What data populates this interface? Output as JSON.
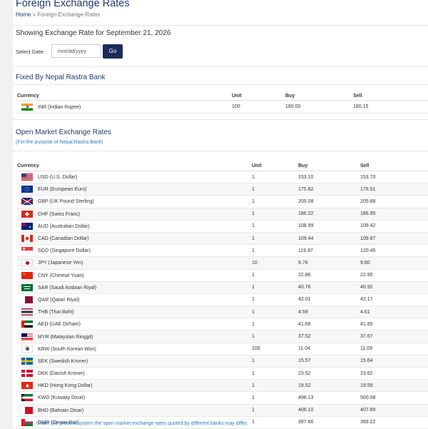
{
  "page": {
    "title": "Foreign Exchange Rates",
    "breadcrumb": {
      "home": "Home",
      "separator": "»",
      "current": "Foreign Exchange Rates"
    }
  },
  "date_form": {
    "heading": "Showing Exchange Rate for September 21, 2026",
    "label": "Select Date:",
    "placeholder": "mm/dd/yyyy",
    "button": "Go"
  },
  "fixed": {
    "heading": "Fixed By Nepal Rastra Bank",
    "columns": [
      "Currency",
      "Unit",
      "Buy",
      "Sell"
    ],
    "rows": [
      {
        "flag": "IN",
        "currency": "INR (Indian Rupee)",
        "unit": "100",
        "buy": "160.00",
        "sell": "160.15"
      }
    ]
  },
  "open_market": {
    "heading": "Open Market Exchange Rates",
    "subheading": "(For the purpose of Nepal Rastra Bank)",
    "columns": [
      "Currency",
      "Unit",
      "Buy",
      "Sell"
    ],
    "rows": [
      {
        "flag": "US",
        "currency": "USD (U.S. Dollar)",
        "unit": "1",
        "buy": "153.10",
        "sell": "153.70"
      },
      {
        "flag": "EU",
        "currency": "EUR (European Euro)",
        "unit": "1",
        "buy": "175.82",
        "sell": "176.51"
      },
      {
        "flag": "GB",
        "currency": "GBP (UK Pound Sterling)",
        "unit": "1",
        "buy": "205.08",
        "sell": "205.88"
      },
      {
        "flag": "CH",
        "currency": "CHF (Swiss Franc)",
        "unit": "1",
        "buy": "186.22",
        "sell": "186.95"
      },
      {
        "flag": "AU",
        "currency": "AUD (Australian Dollar)",
        "unit": "1",
        "buy": "108.99",
        "sell": "109.42"
      },
      {
        "flag": "CA",
        "currency": "CAD (Canadian Dollar)",
        "unit": "1",
        "buy": "109.44",
        "sell": "109.87"
      },
      {
        "flag": "SG",
        "currency": "SGD (Singapore Dollar)",
        "unit": "1",
        "buy": "119.97",
        "sell": "120.45"
      },
      {
        "flag": "JP",
        "currency": "JPY (Japanese Yen)",
        "unit": "10",
        "buy": "9.76",
        "sell": "9.80"
      },
      {
        "flag": "CN",
        "currency": "CNY (Chinese Yuan)",
        "unit": "1",
        "buy": "22.86",
        "sell": "22.95"
      },
      {
        "flag": "SA",
        "currency": "SAR (Saudi Arabian Riyal)",
        "unit": "1",
        "buy": "40.76",
        "sell": "40.92"
      },
      {
        "flag": "QA",
        "currency": "QAR (Qatari Riyal)",
        "unit": "1",
        "buy": "42.01",
        "sell": "42.17"
      },
      {
        "flag": "TH",
        "currency": "THB (Thai Baht)",
        "unit": "1",
        "buy": "4.59",
        "sell": "4.61"
      },
      {
        "flag": "AE",
        "currency": "AED (UAE Dirham)",
        "unit": "1",
        "buy": "41.68",
        "sell": "41.85"
      },
      {
        "flag": "MY",
        "currency": "MYR (Malaysian Ringgit)",
        "unit": "1",
        "buy": "37.52",
        "sell": "37.67"
      },
      {
        "flag": "KR",
        "currency": "KRW (South Korean Won)",
        "unit": "100",
        "buy": "11.04",
        "sell": "11.09"
      },
      {
        "flag": "SE",
        "currency": "SEK (Swedish Kroner)",
        "unit": "1",
        "buy": "15.57",
        "sell": "15.64"
      },
      {
        "flag": "DK",
        "currency": "DKK (Danish Kroner)",
        "unit": "1",
        "buy": "23.52",
        "sell": "23.62"
      },
      {
        "flag": "HK",
        "currency": "HKD (Hong Kong Dollar)",
        "unit": "1",
        "buy": "19.52",
        "sell": "19.59"
      },
      {
        "flag": "KW",
        "currency": "KWD (Kuwaity Dinar)",
        "unit": "1",
        "buy": "498.13",
        "sell": "500.08"
      },
      {
        "flag": "BH",
        "currency": "BHD (Bahrain Dinar)",
        "unit": "1",
        "buy": "406.10",
        "sell": "407.69"
      },
      {
        "flag": "OM",
        "currency": "OMR (Omani Rial)",
        "unit": "1",
        "buy": "397.66",
        "sell": "399.22"
      }
    ]
  },
  "note": "Note: Under the present system the open market exchange rates quoted by different banks may differ.",
  "colors": {
    "heading": "#1f3a6e",
    "button": "#1e2a5a",
    "link": "#2b7cc0"
  }
}
